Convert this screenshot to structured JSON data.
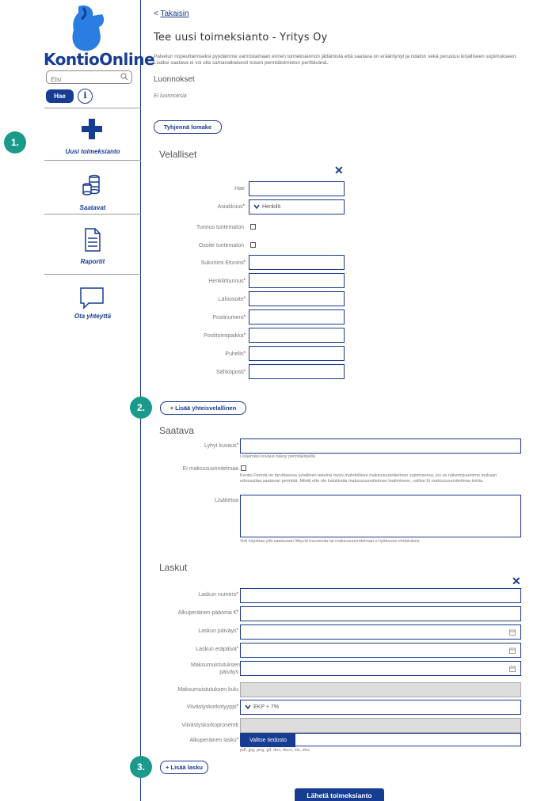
{
  "sidebar": {
    "logo_text": "KontioOnline",
    "search_placeholder": "Etsi",
    "search_button": "Hae",
    "info_icon": "i",
    "nav": [
      {
        "label": "Uusi toimeksianto",
        "icon": "plus-icon"
      },
      {
        "label": "Saatavat",
        "icon": "coins-icon"
      },
      {
        "label": "Raportit",
        "icon": "document-icon"
      },
      {
        "label": "Ota yhteyttä",
        "icon": "chat-icon"
      }
    ]
  },
  "steps": [
    "1.",
    "2.",
    "3."
  ],
  "main": {
    "back_link": "Takaisin",
    "back_arrow": "<",
    "title": "Tee uusi toimeksianto - Yritys Oy",
    "intro": "Palvelun nopeuttamiseksi pyydämme varmistamaan ennen toimeksiannon jättämistä että saatava on erääntynyt ja ridaton sekä perustuu kirjalliseen sopimukseen. Lisäksi saatava ei voi olla samanaikaisesti toisen perintätoimiston perittävänä.",
    "drafts_heading": "Luonnokset",
    "drafts_empty": "Ei luonnoksia",
    "clear_button": "Tyhjennä lomake",
    "debtors": {
      "heading": "Velalliset",
      "close": "✕",
      "fields": {
        "search": "Hae",
        "customer_type": "Asiakkuus",
        "customer_type_value": "Henkilö",
        "id_unknown": "Tunnus tuntematon",
        "address_unknown": "Osoite tuntematon",
        "name": "Sukunimi Etunimi",
        "ssn": "Henkilötunnus",
        "street": "Lähiosoite",
        "postcode": "Postinumero",
        "city": "Postitoimipaikka",
        "phone": "Puhelin",
        "email": "Sähköposti"
      },
      "add_button": "+ Lisää yhteisvelallinen"
    },
    "receivable": {
      "heading": "Saatava",
      "short_desc": "Lyhyt kuvaus",
      "short_desc_help": "Lisäämäsi kuvaus näkyy perintäkirjeillä",
      "no_plan": "Ei maksusuunnitelmaa",
      "no_plan_help": "Kontio Perintä on tarvittaessa ustallinen tekemä myös mahdollisen maksusuunnitelman sopimisessa, jos se näkemyksemme mukaan edesauttaa saatavan perintää. Mikäli ette ole halukkaita maksusuunnitelman laatimiseen, valitse Ei maksusuunnitelmaa-kohta.",
      "notes": "Lisätietoa",
      "notes_help": "Voit kirjoittaa yllä saatavaan liittyviä huomioita tai maksusuunnitelman ei tyäkuvan ehdotuksia"
    },
    "invoices": {
      "heading": "Laskut",
      "close": "✕",
      "fields": {
        "number": "Laskun numero",
        "principal": "Alkuperäinen pääoma €",
        "date": "Laskun päiväys",
        "due": "Laskun eräpäivä",
        "reminder_date": "Maksumuistutuksen päiväys",
        "reminder_fee": "Maksumuistutuksen kulu",
        "interest_type": "Viivästyskorkotyyppi",
        "interest_type_value": "EKP + 7%",
        "interest_percent": "Viivästyskorkoprosentti",
        "original_invoice": "Alkuperäinen lasku",
        "file_button": "Valitse tiedosto",
        "file_types": "pdf, jpg, png, gif, doc, docx, xls, xlsx"
      },
      "add_button": "+ Lisää lasku"
    },
    "submit": "Lähetä toimeksianto"
  }
}
